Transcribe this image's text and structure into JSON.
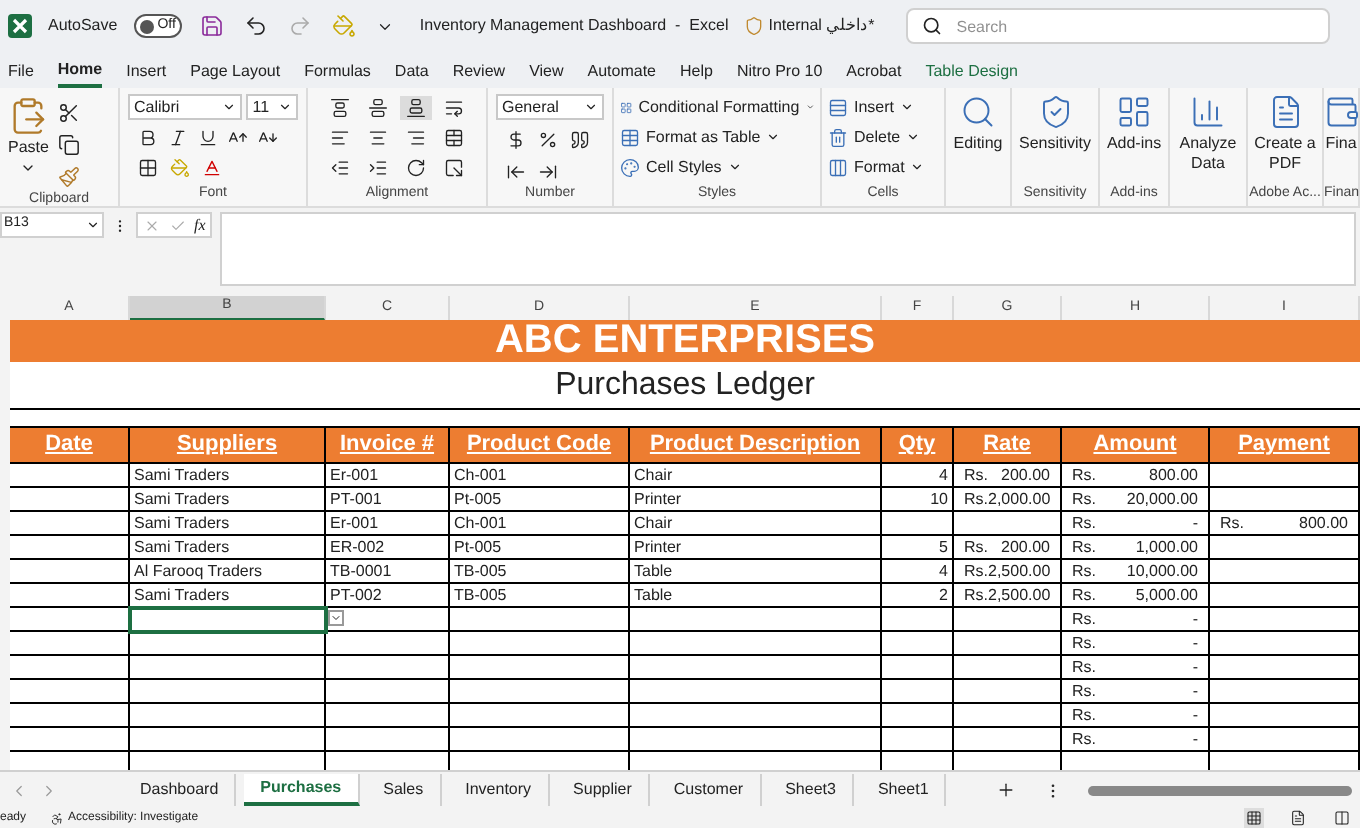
{
  "title_bar": {
    "autosave_label": "AutoSave",
    "autosave": {
      "label": "Off",
      "on": false
    },
    "title": "Inventory Management Dashboard  -  Excel",
    "sensitivity_label": "Internal داخلي*",
    "search": {
      "placeholder": "Search"
    }
  },
  "menu_tabs": [
    {
      "label": "File",
      "selected": false,
      "kind": "standard"
    },
    {
      "label": "Home",
      "selected": true,
      "kind": "standard"
    },
    {
      "label": "Insert",
      "selected": false,
      "kind": "standard"
    },
    {
      "label": "Page Layout",
      "selected": false,
      "kind": "standard"
    },
    {
      "label": "Formulas",
      "selected": false,
      "kind": "standard"
    },
    {
      "label": "Data",
      "selected": false,
      "kind": "standard"
    },
    {
      "label": "Review",
      "selected": false,
      "kind": "standard"
    },
    {
      "label": "View",
      "selected": false,
      "kind": "standard"
    },
    {
      "label": "Automate",
      "selected": false,
      "kind": "standard"
    },
    {
      "label": "Help",
      "selected": false,
      "kind": "standard"
    },
    {
      "label": "Nitro Pro 10",
      "selected": false,
      "kind": "standard"
    },
    {
      "label": "Acrobat",
      "selected": false,
      "kind": "standard"
    },
    {
      "label": "Table Design",
      "selected": false,
      "kind": "contextual"
    }
  ],
  "ribbon": {
    "groups": [
      {
        "kind": "clipboard",
        "label": "Clipboard",
        "paste": "Paste"
      },
      {
        "kind": "font",
        "label": "Font",
        "font_name": "Calibri",
        "font_size": "11"
      },
      {
        "kind": "alignment",
        "label": "Alignment"
      },
      {
        "kind": "number",
        "label": "Number",
        "format": "General"
      },
      {
        "kind": "list",
        "label": "Styles",
        "items": [
          "Conditional Formatting",
          "Format as Table",
          "Cell Styles"
        ]
      },
      {
        "kind": "list",
        "label": "Cells",
        "items": [
          "Insert",
          "Delete",
          "Format"
        ]
      },
      {
        "kind": "big",
        "buttons": [
          "Editing"
        ]
      },
      {
        "kind": "big",
        "label": "Sensitivity",
        "buttons": [
          "Sensitivity"
        ]
      },
      {
        "kind": "big",
        "label": "Add-ins",
        "buttons": [
          "Add-ins"
        ]
      },
      {
        "kind": "big",
        "buttons": [
          "Analyze Data"
        ]
      },
      {
        "kind": "big",
        "label": "Adobe Ac...",
        "buttons": [
          "Create a PDF"
        ]
      },
      {
        "kind": "big",
        "label": "Finan",
        "buttons": [
          "Fina"
        ]
      }
    ]
  },
  "formula_bar": {
    "name_box": "B13",
    "fx": "fx"
  },
  "columns": [
    {
      "letter": "A",
      "selected": false
    },
    {
      "letter": "B",
      "selected": true
    },
    {
      "letter": "C",
      "selected": false
    },
    {
      "letter": "D",
      "selected": false
    },
    {
      "letter": "E",
      "selected": false
    },
    {
      "letter": "F",
      "selected": false
    },
    {
      "letter": "G",
      "selected": false
    },
    {
      "letter": "H",
      "selected": false
    },
    {
      "letter": "I",
      "selected": false
    }
  ],
  "sheet": {
    "title": "ABC ENTERPRISES",
    "subtitle": "Purchases Ledger",
    "headers": [
      "Date",
      "Suppliers",
      "Invoice #",
      "Product Code",
      "Product Description",
      "Qty",
      "Rate",
      "Amount",
      "Payment"
    ],
    "rows": [
      {
        "supplier": "Sami Traders",
        "invoice": "Er-001",
        "product_code": "Ch-001",
        "description": "Chair",
        "qty": "4",
        "rate": {
          "currency": "Rs.",
          "value": "200.00"
        },
        "amount": {
          "currency": "Rs.",
          "value": "800.00"
        },
        "supplier_active": false
      },
      {
        "supplier": "Sami Traders",
        "invoice": "PT-001",
        "product_code": "Pt-005",
        "description": "Printer",
        "qty": "10",
        "rate": {
          "currency": "Rs.",
          "value": "2,000.00"
        },
        "amount": {
          "currency": "Rs.",
          "value": "20,000.00"
        },
        "supplier_active": false
      },
      {
        "supplier": "Sami Traders",
        "invoice": "Er-001",
        "product_code": "Ch-001",
        "description": "Chair",
        "amount": {
          "currency": "Rs.",
          "value": "-"
        },
        "payment": {
          "currency": "Rs.",
          "value": "800.00"
        },
        "supplier_active": false
      },
      {
        "supplier": "Sami Traders",
        "invoice": "ER-002",
        "product_code": "Pt-005",
        "description": "Printer",
        "qty": "5",
        "rate": {
          "currency": "Rs.",
          "value": "200.00"
        },
        "amount": {
          "currency": "Rs.",
          "value": "1,000.00"
        },
        "supplier_active": false
      },
      {
        "supplier": "Al Farooq Traders",
        "invoice": "TB-0001",
        "product_code": "TB-005",
        "description": "Table",
        "qty": "4",
        "rate": {
          "currency": "Rs.",
          "value": "2,500.00"
        },
        "amount": {
          "currency": "Rs.",
          "value": "10,000.00"
        },
        "supplier_active": false
      },
      {
        "supplier": "Sami Traders",
        "invoice": "PT-002",
        "product_code": "TB-005",
        "description": "Table",
        "qty": "2",
        "rate": {
          "currency": "Rs.",
          "value": "2,500.00"
        },
        "amount": {
          "currency": "Rs.",
          "value": "5,000.00"
        },
        "supplier_active": false
      },
      {
        "amount": {
          "currency": "Rs.",
          "value": "-"
        },
        "supplier_active": true
      },
      {
        "amount": {
          "currency": "Rs.",
          "value": "-"
        },
        "supplier_active": false
      },
      {
        "amount": {
          "currency": "Rs.",
          "value": "-"
        },
        "supplier_active": false
      },
      {
        "amount": {
          "currency": "Rs.",
          "value": "-"
        },
        "supplier_active": false
      },
      {
        "amount": {
          "currency": "Rs.",
          "value": "-"
        },
        "supplier_active": false
      },
      {
        "amount": {
          "currency": "Rs.",
          "value": "-"
        },
        "supplier_active": false
      }
    ]
  },
  "sheet_tabs": [
    {
      "label": "Dashboard",
      "selected": false
    },
    {
      "label": "Purchases",
      "selected": true
    },
    {
      "label": "Sales",
      "selected": false
    },
    {
      "label": "Inventory",
      "selected": false
    },
    {
      "label": "Supplier",
      "selected": false
    },
    {
      "label": "Customer",
      "selected": false
    },
    {
      "label": "Sheet3",
      "selected": false
    },
    {
      "label": "Sheet1",
      "selected": false
    }
  ],
  "status_bar": {
    "mode": "eady",
    "accessibility": "Accessibility: Investigate"
  }
}
